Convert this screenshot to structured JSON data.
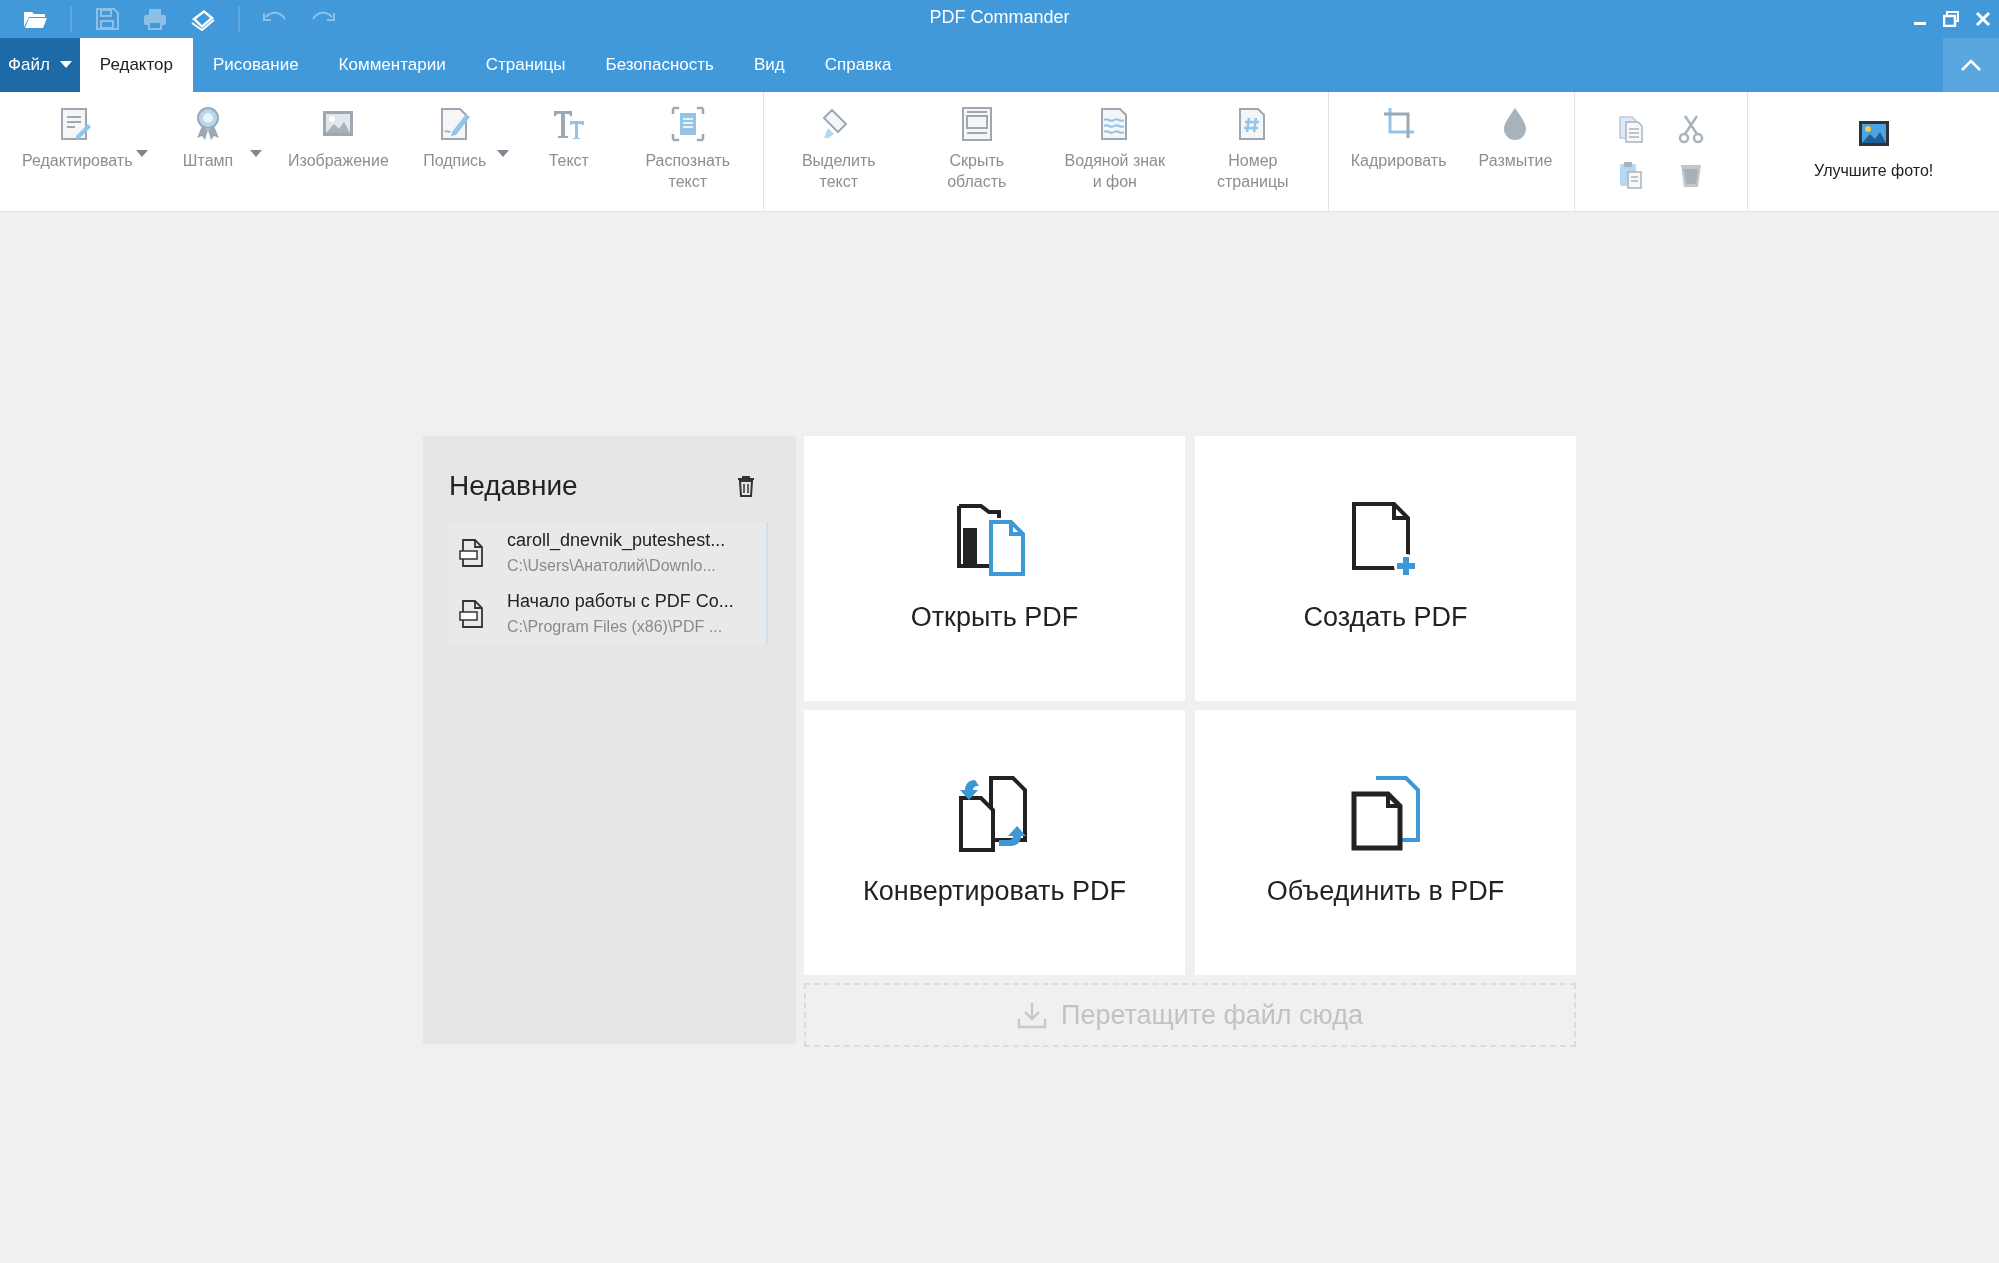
{
  "window": {
    "title": "PDF Commander"
  },
  "quick_access": [
    {
      "kind": "open",
      "disabled": false
    },
    {
      "kind": "save",
      "disabled": true
    },
    {
      "kind": "print",
      "disabled": true
    },
    {
      "kind": "scan",
      "disabled": false
    },
    {
      "kind": "undo",
      "disabled": true
    },
    {
      "kind": "redo",
      "disabled": true
    }
  ],
  "tabs": [
    {
      "label": "Файл",
      "kind": "menu",
      "selected": false
    },
    {
      "label": "Редактор",
      "kind": "tab",
      "selected": true
    },
    {
      "label": "Рисование",
      "kind": "tab",
      "selected": false
    },
    {
      "label": "Комментарии",
      "kind": "tab",
      "selected": false
    },
    {
      "label": "Страницы",
      "kind": "tab",
      "selected": false
    },
    {
      "label": "Безопасность",
      "kind": "tab",
      "selected": false
    },
    {
      "label": "Вид",
      "kind": "tab",
      "selected": false
    },
    {
      "label": "Справка",
      "kind": "tab",
      "selected": false
    }
  ],
  "ribbon": {
    "groups": [
      {
        "kind": "large",
        "items": [
          {
            "kind": "edit",
            "label": "Редактировать",
            "disabled": true,
            "has_menu": true
          },
          {
            "kind": "stamp",
            "label": "Штамп",
            "disabled": true,
            "has_menu": true
          },
          {
            "kind": "image",
            "label": "Изображение",
            "disabled": true,
            "has_menu": false
          },
          {
            "kind": "signature",
            "label": "Подпись",
            "disabled": true,
            "has_menu": true
          },
          {
            "kind": "text",
            "label": "Текст",
            "disabled": true,
            "has_menu": false
          },
          {
            "kind": "ocr",
            "label": "Распознать текст",
            "disabled": true,
            "has_menu": false
          }
        ]
      },
      {
        "kind": "large",
        "items": [
          {
            "kind": "highlight",
            "label": "Выделить текст",
            "disabled": true,
            "has_menu": false
          },
          {
            "kind": "hide",
            "label": "Скрыть область",
            "disabled": true,
            "has_menu": false
          },
          {
            "kind": "watermark",
            "label": "Водяной знак и фон",
            "disabled": true,
            "has_menu": false
          },
          {
            "kind": "pagenum",
            "label": "Номер страницы",
            "disabled": true,
            "has_menu": false
          }
        ]
      },
      {
        "kind": "large",
        "items": [
          {
            "kind": "crop",
            "label": "Кадрировать",
            "disabled": true,
            "has_menu": false
          },
          {
            "kind": "blur",
            "label": "Размытие",
            "disabled": true,
            "has_menu": false
          }
        ]
      },
      {
        "kind": "small",
        "items": [
          {
            "kind": "copy",
            "disabled": true
          },
          {
            "kind": "cut",
            "disabled": true
          },
          {
            "kind": "paste",
            "disabled": true
          },
          {
            "kind": "delete",
            "disabled": true
          }
        ]
      },
      {
        "kind": "large",
        "items": [
          {
            "kind": "photo",
            "label": "Улучшите фото!",
            "disabled": false,
            "has_menu": false
          }
        ]
      }
    ]
  },
  "recent": {
    "title": "Недавние",
    "items": [
      {
        "name": "caroll_dnevnik_puteshest...",
        "path": "C:\\Users\\Анатолий\\Downlo..."
      },
      {
        "name": "Начало работы с PDF Co...",
        "path": "C:\\Program Files (x86)\\PDF ..."
      }
    ]
  },
  "actions": [
    {
      "kind": "open",
      "label": "Открыть PDF"
    },
    {
      "kind": "create",
      "label": "Создать PDF"
    },
    {
      "kind": "convert",
      "label": "Конвертировать PDF"
    },
    {
      "kind": "merge",
      "label": "Объединить в PDF"
    }
  ],
  "drop_zone": {
    "text": "Перетащите файл сюда"
  }
}
